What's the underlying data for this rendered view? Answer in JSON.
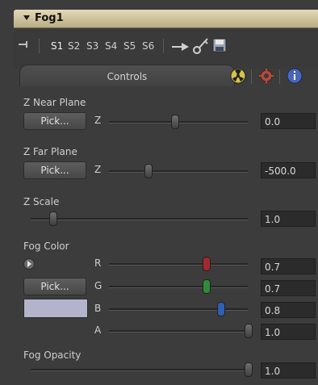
{
  "node": {
    "title": "Fog1"
  },
  "toolbar": {
    "settings": [
      "S1",
      "S2",
      "S3",
      "S4",
      "S5",
      "S6"
    ]
  },
  "tabs": {
    "controls_label": "Controls"
  },
  "z_near": {
    "label": "Z Near Plane",
    "pick_label": "Pick...",
    "axis": "Z",
    "value": "0.0",
    "slider_level": 0.47
  },
  "z_far": {
    "label": "Z Far Plane",
    "pick_label": "Pick...",
    "axis": "Z",
    "value": "-500.0",
    "slider_level": 0.28
  },
  "z_scale": {
    "label": "Z Scale",
    "value": "1.0",
    "slider_level": 0.1
  },
  "fog_color": {
    "label": "Fog Color",
    "pick_label": "Pick...",
    "swatch_color": "#b3b3cc",
    "channels": [
      {
        "name": "R",
        "value": "0.7",
        "slider_level": 0.7,
        "knob_color": "#a22a2a"
      },
      {
        "name": "G",
        "value": "0.7",
        "slider_level": 0.7,
        "knob_color": "#2f8a3a"
      },
      {
        "name": "B",
        "value": "0.8",
        "slider_level": 0.8,
        "knob_color": "#2e5fb4"
      },
      {
        "name": "A",
        "value": "1.0",
        "slider_level": 1.0,
        "knob_color": "#6f6f6f"
      }
    ]
  },
  "fog_opacity": {
    "label": "Fog Opacity",
    "value": "1.0",
    "slider_level": 1.0
  }
}
